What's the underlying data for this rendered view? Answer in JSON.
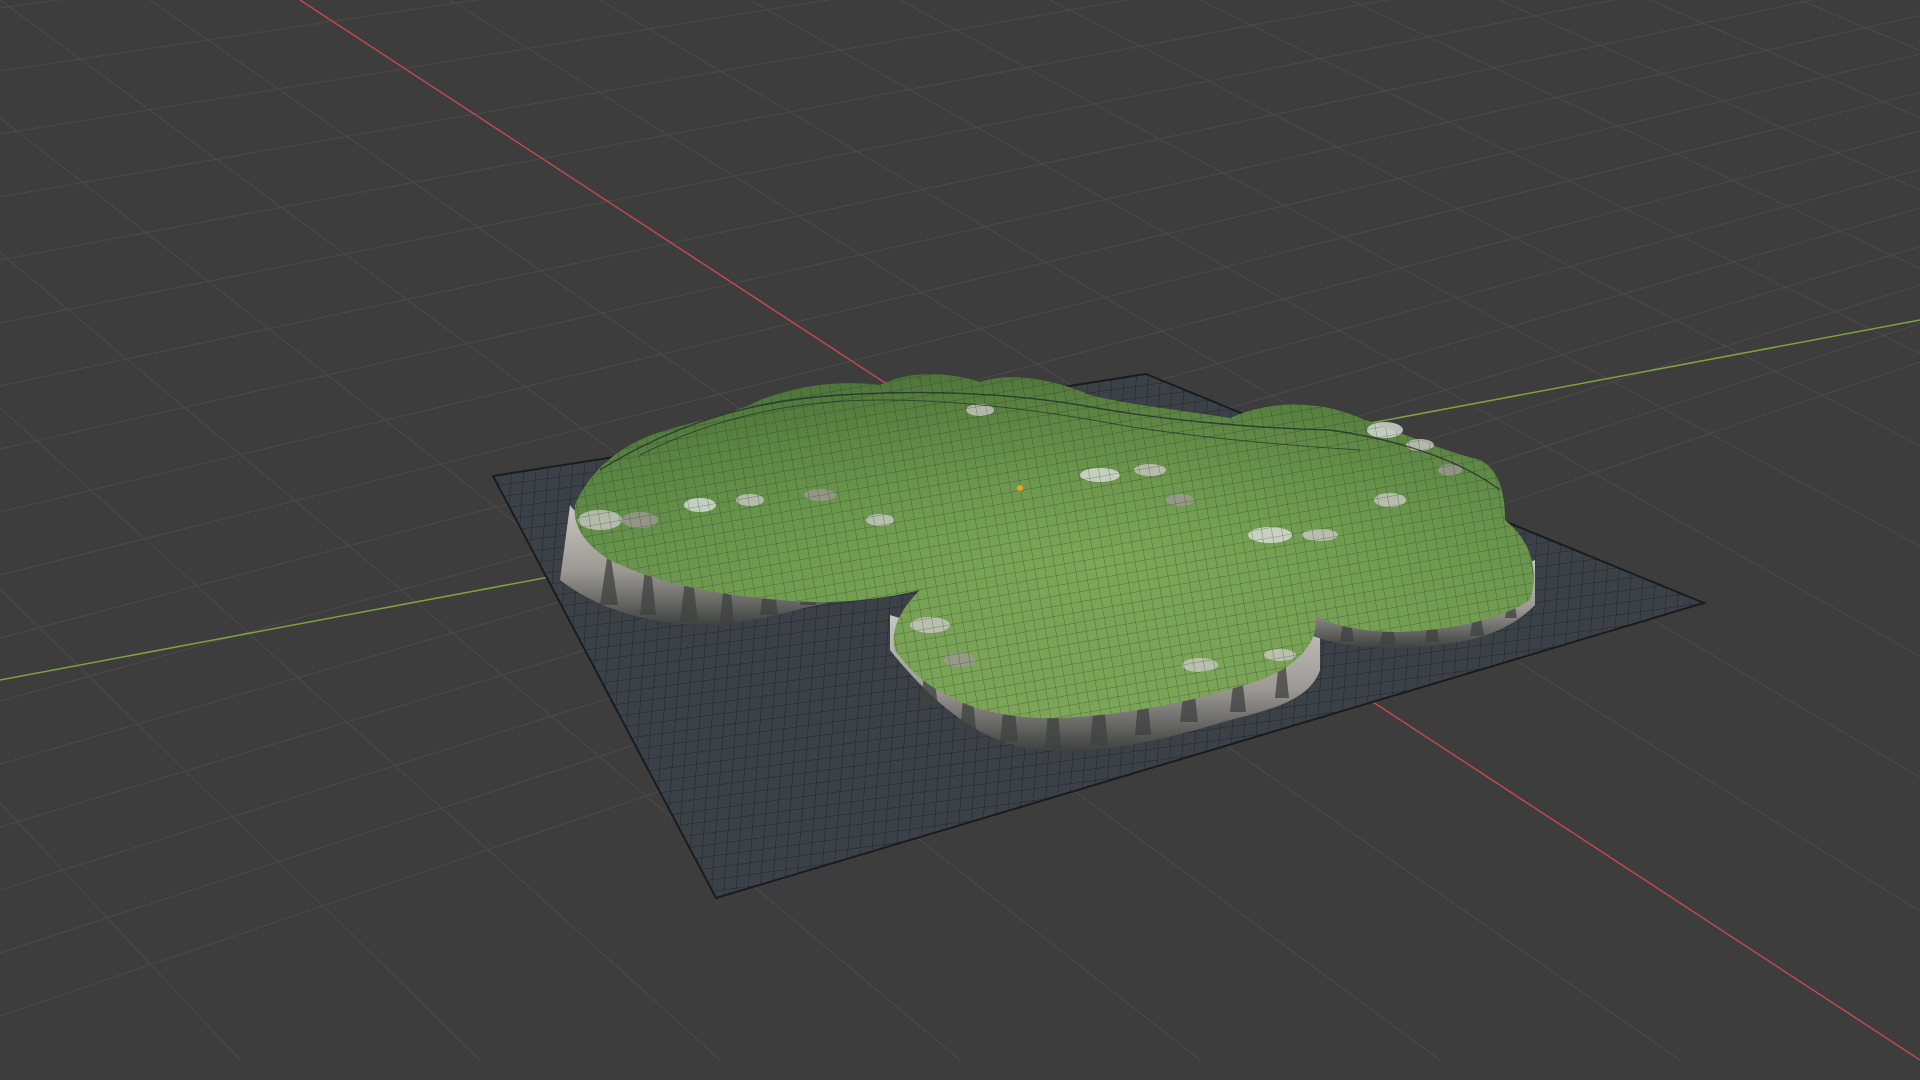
{
  "viewport": {
    "type": "3d-viewport",
    "background_color": "#3d3d3d",
    "floor_grid_color": "#4b4b4b",
    "x_axis_color": "#c2464f",
    "y_axis_color": "#7ea33a",
    "object": {
      "kind": "terrain-mesh",
      "shading": "solid-with-wireframe-overlay",
      "base_plane_color": "#3b4146",
      "wire_color": "#1e2226",
      "terrain_colors": {
        "grass_light": "#7aa356",
        "grass": "#5f8c46",
        "grass_dark": "#4d7438",
        "rock_light": "#c9c7c3",
        "rock_mid": "#9c9893",
        "cliff_shadow": "#3f4240",
        "snow": "#dcdedd"
      }
    },
    "origin_marker_color": "#f0a020"
  }
}
